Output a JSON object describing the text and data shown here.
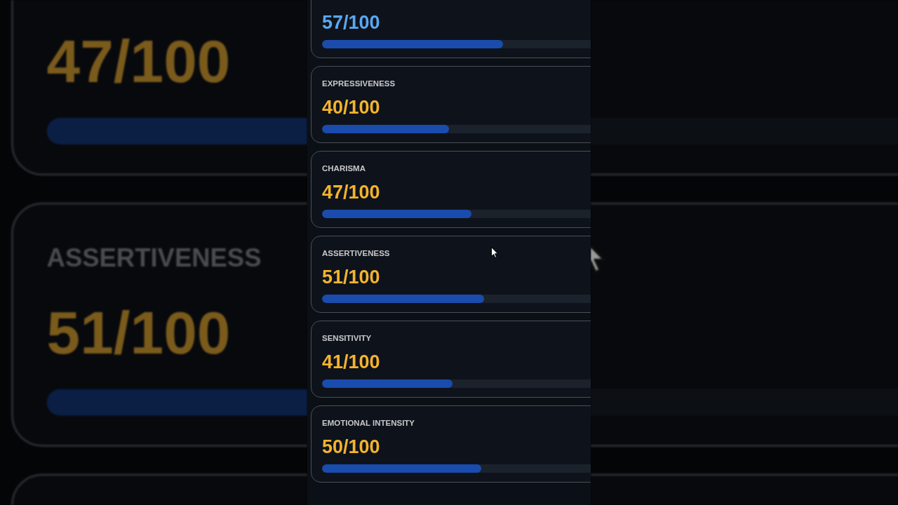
{
  "backdrop": {
    "cards": [
      {
        "value": "47/100",
        "color": "#7a5b1c",
        "level": 0.47
      },
      {
        "label": "ASSERTIVENESS",
        "value": "51/100",
        "color": "#7a5b1c",
        "level": 0.51
      }
    ]
  },
  "cards": [
    {
      "value": "57/100",
      "color": "#5aa8f2",
      "level": 0.57
    },
    {
      "label": "EXPRESSIVENESS",
      "value": "40/100",
      "color": "#f4b32e",
      "level": 0.4
    },
    {
      "label": "CHARISMA",
      "value": "47/100",
      "color": "#f4b32e",
      "level": 0.47
    },
    {
      "label": "ASSERTIVENESS",
      "value": "51/100",
      "color": "#f4b32e",
      "level": 0.51
    },
    {
      "label": "SENSITIVITY",
      "value": "41/100",
      "color": "#f4b32e",
      "level": 0.41
    },
    {
      "label": "EMOTIONAL INTENSITY",
      "value": "50/100",
      "color": "#f4b32e",
      "level": 0.5
    }
  ]
}
